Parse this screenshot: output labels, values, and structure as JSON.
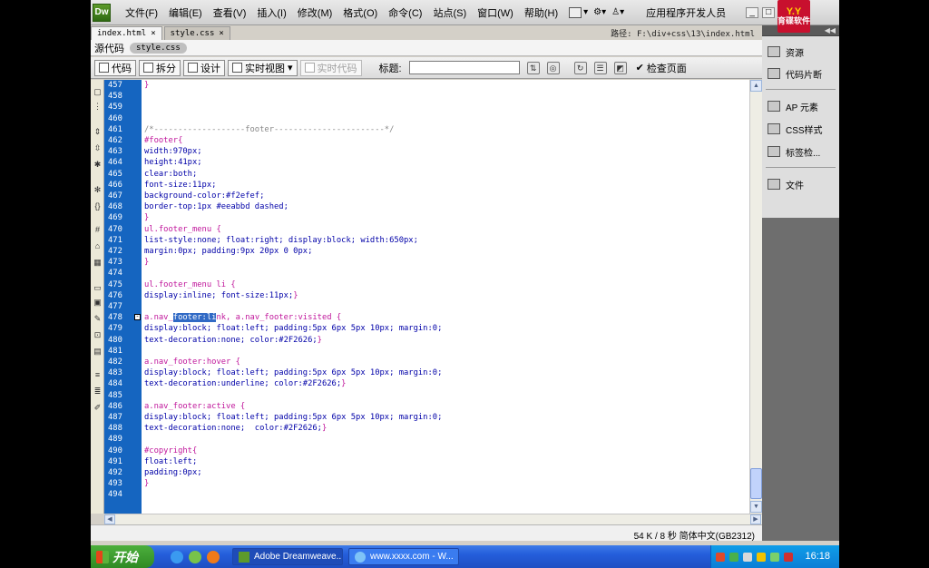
{
  "app": {
    "logo": "Dw",
    "menu": [
      "文件(F)",
      "编辑(E)",
      "查看(V)",
      "插入(I)",
      "修改(M)",
      "格式(O)",
      "命令(C)",
      "站点(S)",
      "窗口(W)",
      "帮助(H)"
    ],
    "workspace": "应用程序开发人员",
    "brand_top": "Y.Y",
    "brand_bottom": "育碟软件"
  },
  "tabs": [
    {
      "label": "index.html",
      "close": "×"
    },
    {
      "label": "style.css",
      "close": "×"
    }
  ],
  "path": "路径:  F:\\div+css\\13\\index.html",
  "related": {
    "source": "源代码",
    "file": "style.css"
  },
  "toolbar": {
    "code": "代码",
    "split": "拆分",
    "design": "设计",
    "live_view": "实时视图",
    "live_code": "实时代码",
    "title_label": "标题:",
    "title_value": "",
    "check_page": "检查页面"
  },
  "code_lines": [
    {
      "n": "457",
      "parts": [
        {
          "t": "}",
          "c": "c-sel"
        }
      ]
    },
    {
      "n": "458",
      "parts": []
    },
    {
      "n": "459",
      "parts": []
    },
    {
      "n": "460",
      "parts": []
    },
    {
      "n": "461",
      "parts": [
        {
          "t": "/*-------------------footer-----------------------*/",
          "c": "c-com"
        }
      ]
    },
    {
      "n": "462",
      "parts": [
        {
          "t": "#footer{",
          "c": "c-sel"
        }
      ]
    },
    {
      "n": "463",
      "parts": [
        {
          "t": "width:970px;",
          "c": "c-prop"
        }
      ]
    },
    {
      "n": "464",
      "parts": [
        {
          "t": "height:41px;",
          "c": "c-prop"
        }
      ]
    },
    {
      "n": "465",
      "parts": [
        {
          "t": "clear:both;",
          "c": "c-prop"
        }
      ]
    },
    {
      "n": "466",
      "parts": [
        {
          "t": "font-size:11px;",
          "c": "c-prop"
        }
      ]
    },
    {
      "n": "467",
      "parts": [
        {
          "t": "background-color:#f2efef;",
          "c": "c-prop"
        }
      ]
    },
    {
      "n": "468",
      "parts": [
        {
          "t": "border-top:1px #eeabbd dashed;",
          "c": "c-prop"
        }
      ]
    },
    {
      "n": "469",
      "parts": [
        {
          "t": "}",
          "c": "c-sel"
        }
      ]
    },
    {
      "n": "470",
      "parts": [
        {
          "t": "ul.footer_menu {",
          "c": "c-sel"
        }
      ]
    },
    {
      "n": "471",
      "parts": [
        {
          "t": "list-style:none; float:right; display:block; width:650px;",
          "c": "c-prop"
        }
      ]
    },
    {
      "n": "472",
      "parts": [
        {
          "t": "margin:0px; padding:9px 20px 0 0px;",
          "c": "c-prop"
        }
      ]
    },
    {
      "n": "473",
      "parts": [
        {
          "t": "}",
          "c": "c-sel"
        }
      ]
    },
    {
      "n": "474",
      "parts": []
    },
    {
      "n": "475",
      "parts": [
        {
          "t": "ul.footer_menu li {",
          "c": "c-sel"
        }
      ]
    },
    {
      "n": "476",
      "parts": [
        {
          "t": "display:inline; font-size:11px;",
          "c": "c-prop"
        },
        {
          "t": "}",
          "c": "c-sel"
        }
      ]
    },
    {
      "n": "477",
      "parts": []
    },
    {
      "n": "478",
      "fold": "-",
      "parts": [
        {
          "t": "a.nav_",
          "c": "c-sel"
        },
        {
          "t": "footer:li",
          "c": "hl"
        },
        {
          "t": "nk, a.nav_footer:visited {",
          "c": "c-sel"
        }
      ]
    },
    {
      "n": "479",
      "parts": [
        {
          "t": "display:block; float:left; padding:5px 6px 5px 10px; margin:0;",
          "c": "c-prop"
        }
      ]
    },
    {
      "n": "480",
      "parts": [
        {
          "t": "text-decoration:none; color:#2F2626;",
          "c": "c-prop"
        },
        {
          "t": "}",
          "c": "c-sel"
        }
      ]
    },
    {
      "n": "481",
      "parts": []
    },
    {
      "n": "482",
      "parts": [
        {
          "t": "a.nav_footer:hover {",
          "c": "c-sel"
        }
      ]
    },
    {
      "n": "483",
      "parts": [
        {
          "t": "display:block; float:left; padding:5px 6px 5px 10px; margin:0;",
          "c": "c-prop"
        }
      ]
    },
    {
      "n": "484",
      "parts": [
        {
          "t": "text-decoration:underline; color:#2F2626;",
          "c": "c-prop"
        },
        {
          "t": "}",
          "c": "c-sel"
        }
      ]
    },
    {
      "n": "485",
      "parts": []
    },
    {
      "n": "486",
      "parts": [
        {
          "t": "a.nav_footer:active {",
          "c": "c-sel"
        }
      ]
    },
    {
      "n": "487",
      "parts": [
        {
          "t": "display:block; float:left; padding:5px 6px 5px 10px; margin:0;",
          "c": "c-prop"
        }
      ]
    },
    {
      "n": "488",
      "parts": [
        {
          "t": "text-decoration:none;  color:#2F2626;",
          "c": "c-prop"
        },
        {
          "t": "}",
          "c": "c-sel"
        }
      ]
    },
    {
      "n": "489",
      "parts": []
    },
    {
      "n": "490",
      "parts": [
        {
          "t": "#copyright{",
          "c": "c-sel"
        }
      ]
    },
    {
      "n": "491",
      "parts": [
        {
          "t": "float:left;",
          "c": "c-prop"
        }
      ]
    },
    {
      "n": "492",
      "parts": [
        {
          "t": "padding:0px;",
          "c": "c-prop"
        }
      ]
    },
    {
      "n": "493",
      "parts": [
        {
          "t": "}",
          "c": "c-sel"
        }
      ]
    },
    {
      "n": "494",
      "parts": []
    }
  ],
  "status": "54 K / 8 秒  简体中文(GB2312)",
  "panels": [
    "资源",
    "代码片断",
    "AP 元素",
    "CSS样式",
    "标签检...",
    "文件"
  ],
  "taskbar": {
    "start": "开始",
    "tasks": [
      "Adobe Dreamweave...",
      "www.xxxx.com - W..."
    ],
    "clock": "16:18"
  },
  "colors": {
    "gutter": "#1565c0",
    "selector": "#c0169b",
    "property": "#0000a8",
    "taskbar": "#245edb"
  }
}
